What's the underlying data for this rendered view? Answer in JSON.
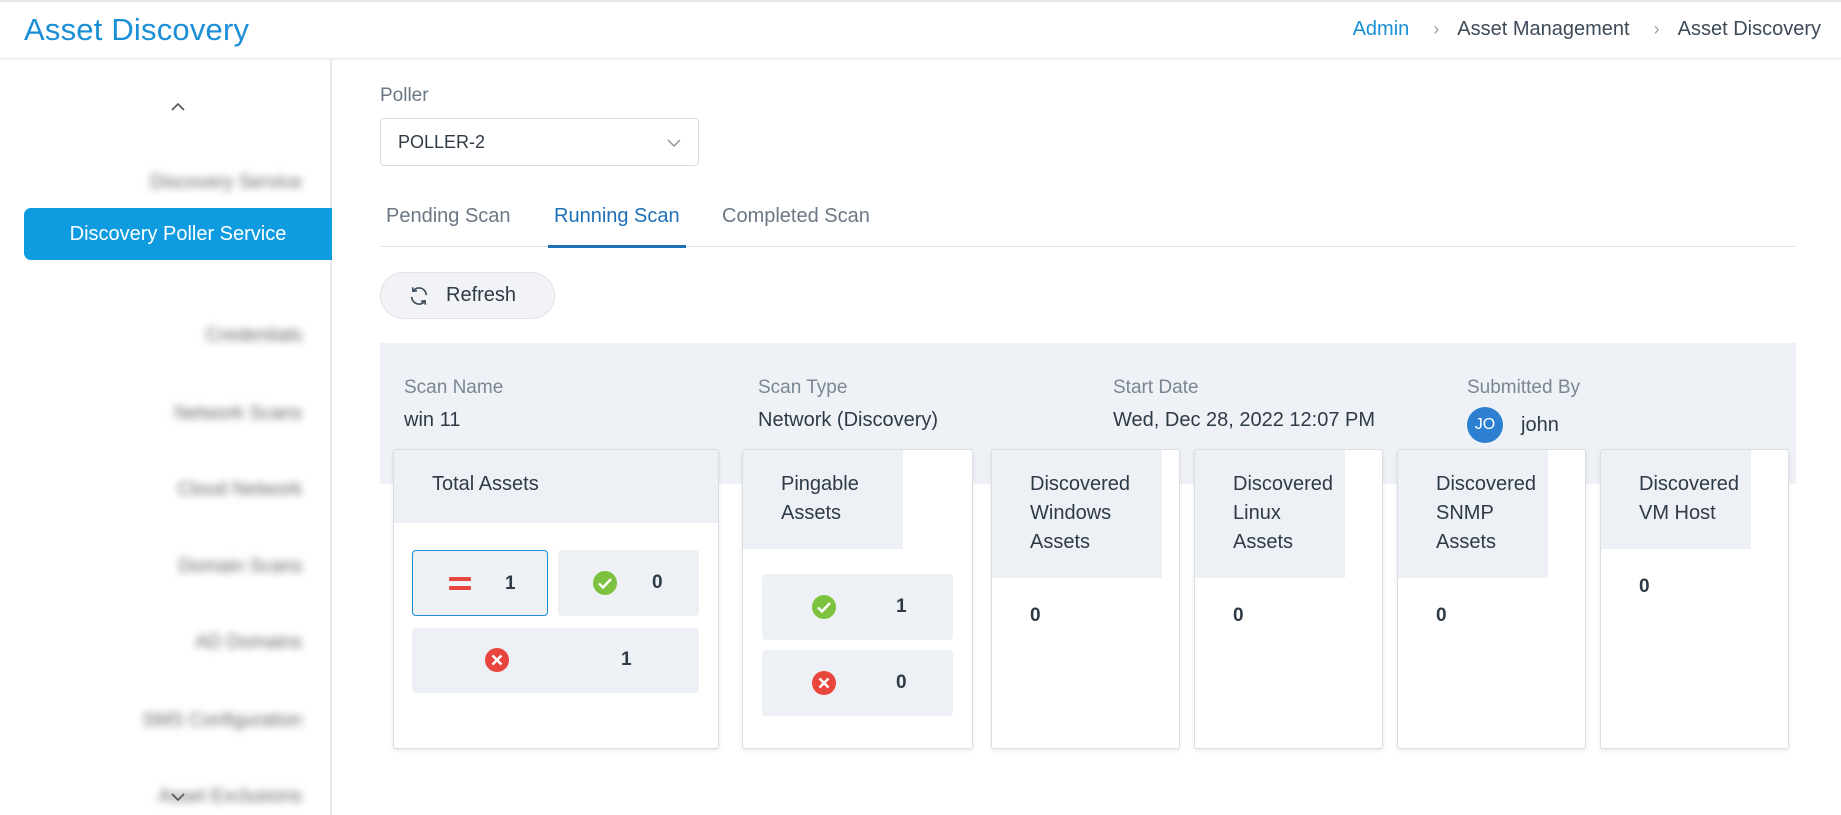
{
  "header": {
    "title": "Asset Discovery",
    "breadcrumb": [
      "Admin",
      "Asset Management",
      "Asset Discovery"
    ]
  },
  "sidebar": {
    "items": [
      {
        "label": "Discovery Service",
        "blurred": true
      },
      {
        "label": "Discovery Poller Service",
        "active": true
      },
      {
        "label": "Credentials",
        "blurred": true
      },
      {
        "label": "Network Scans",
        "blurred": true
      },
      {
        "label": "Cloud Network",
        "blurred": true
      },
      {
        "label": "Domain Scans",
        "blurred": true
      },
      {
        "label": "AD Domains",
        "blurred": true
      },
      {
        "label": "SMS Configuration",
        "blurred": true
      },
      {
        "label": "Asset Exclusions",
        "blurred": true
      }
    ]
  },
  "poller": {
    "label": "Poller",
    "selected": "POLLER-2"
  },
  "tabs": [
    {
      "label": "Pending Scan",
      "active": false
    },
    {
      "label": "Running Scan",
      "active": true
    },
    {
      "label": "Completed Scan",
      "active": false
    }
  ],
  "refresh_label": "Refresh",
  "scan": {
    "name_label": "Scan Name",
    "name": "win 11",
    "type_label": "Scan Type",
    "type": "Network (Discovery)",
    "date_label": "Start Date",
    "date": "Wed, Dec 28, 2022 12:07 PM",
    "submitted_label": "Submitted By",
    "user_initials": "JO",
    "user": "john"
  },
  "cards": {
    "total": {
      "title": "Total Assets",
      "all": "1",
      "success": "0",
      "failed": "1"
    },
    "pingable": {
      "title": "Pingable Assets",
      "success": "1",
      "failed": "0"
    },
    "windows": {
      "title": "Discovered Windows Assets",
      "value": "0"
    },
    "linux": {
      "title": "Discovered Linux Assets",
      "value": "0"
    },
    "snmp": {
      "title": "Discovered SNMP Assets",
      "value": "0"
    },
    "vm": {
      "title": "Discovered VM Host",
      "value": "0"
    }
  },
  "colors": {
    "accent": "#1a8fd8",
    "active_item": "#0e9be0",
    "success": "#7cc23f",
    "error": "#e8453c"
  }
}
